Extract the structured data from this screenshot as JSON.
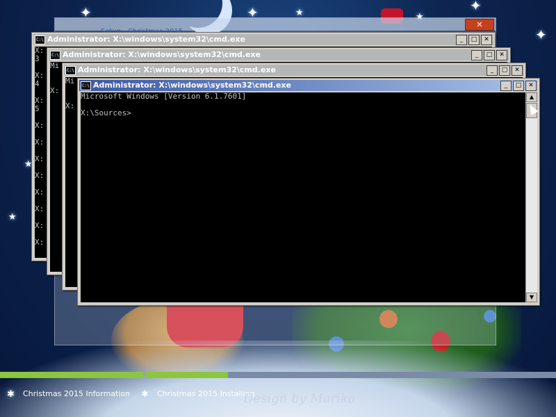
{
  "installer": {
    "title": "Setup - Christmas 2015",
    "close_label": "✕"
  },
  "windows": [
    {
      "title": "Administrator: X:\\windows\\system32\\cmd.exe",
      "lines": "X:\n3\n\nX:\n4\n\nX:\n5\n\nX:\n\nX:\n\nX:\n\nX:\n\nX:\n\nX:\n\nX:\n\nX:"
    },
    {
      "title": "Administrator: X:\\windows\\system32\\cmd.exe",
      "lines": "Mi\n\n\nX:"
    },
    {
      "title": "Administrator: X:\\windows\\system32\\cmd.exe",
      "lines": "Mi\n\n\nX:"
    },
    {
      "title": "Administrator: X:\\windows\\system32\\cmd.exe",
      "lines": "Microsoft Windows [Version 6.1.7601]\n\nX:\\Sources>"
    }
  ],
  "controls": {
    "minimize": "_",
    "maximize": "□",
    "close": "✕",
    "up": "▲",
    "down": "▼",
    "sysicon": "C:\\"
  },
  "progress": [
    {
      "label": "Christmas 2015 Information",
      "fraction": 1.0
    },
    {
      "label": "Christmas 2015 Installing",
      "fraction": 0.2
    }
  ],
  "watermark": "Design by Marika",
  "colors": {
    "progress_fill": "#8cc63e",
    "progress_track": "#7a8ba8",
    "title_active": "#3a58a8"
  }
}
